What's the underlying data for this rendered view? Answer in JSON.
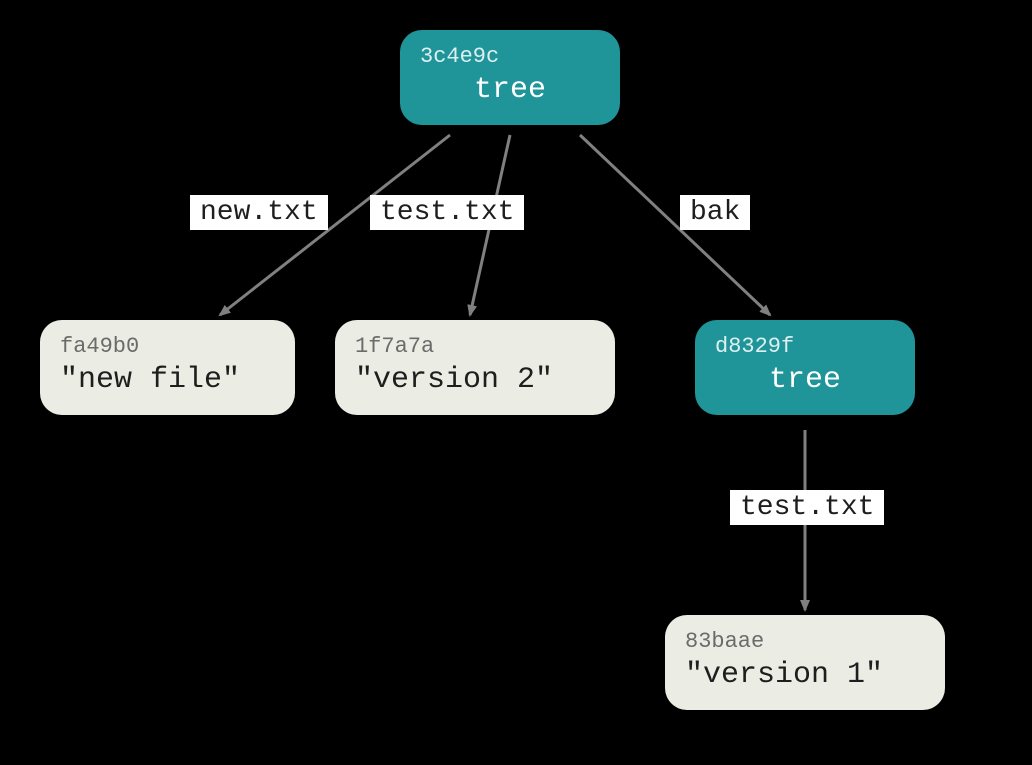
{
  "nodes": {
    "root": {
      "hash": "3c4e9c",
      "label": "tree",
      "type": "tree"
    },
    "new_file": {
      "hash": "fa49b0",
      "label": "\"new file\"",
      "type": "blob"
    },
    "version2": {
      "hash": "1f7a7a",
      "label": "\"version 2\"",
      "type": "blob"
    },
    "bak_tree": {
      "hash": "d8329f",
      "label": "tree",
      "type": "tree"
    },
    "version1": {
      "hash": "83baae",
      "label": "\"version 1\"",
      "type": "blob"
    }
  },
  "edges": {
    "root_new": "new.txt",
    "root_test": "test.txt",
    "root_bak": "bak",
    "bak_test": "test.txt"
  },
  "colors": {
    "tree_bg": "#1f9599",
    "blob_bg": "#ebece3",
    "arrow": "#808080"
  }
}
